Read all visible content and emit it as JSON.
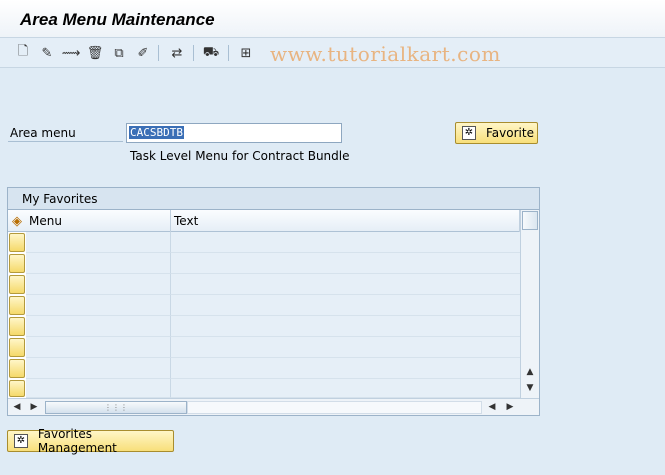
{
  "window": {
    "title": "Area Menu Maintenance"
  },
  "toolbar": {
    "buttons": [
      {
        "name": "create-icon",
        "glyph": "🗋"
      },
      {
        "name": "change-icon",
        "glyph": "✎"
      },
      {
        "name": "display-icon",
        "glyph": "⟿"
      },
      {
        "name": "delete-icon",
        "glyph": "🗑"
      },
      {
        "name": "copy-icon",
        "glyph": "⧉"
      },
      {
        "name": "edit-icon",
        "glyph": "✐"
      },
      {
        "name": "transport-icon",
        "glyph": "⇄"
      },
      {
        "name": "truck-icon",
        "glyph": "⛟"
      },
      {
        "name": "import-icon",
        "glyph": "⊞"
      }
    ],
    "watermark": "www.tutorialkart.com"
  },
  "form": {
    "area_menu_label": "Area menu",
    "area_menu_value": "CACSBDTB",
    "description": "Task Level Menu for Contract Bundle",
    "favorite_button": "Favorite"
  },
  "favorites": {
    "panel_title": "My Favorites",
    "columns": [
      "Menu",
      "Text"
    ],
    "rows": [
      {
        "menu": "",
        "text": ""
      },
      {
        "menu": "",
        "text": ""
      },
      {
        "menu": "",
        "text": ""
      },
      {
        "menu": "",
        "text": ""
      },
      {
        "menu": "",
        "text": ""
      },
      {
        "menu": "",
        "text": ""
      },
      {
        "menu": "",
        "text": ""
      },
      {
        "menu": "",
        "text": ""
      }
    ]
  },
  "footer": {
    "favorites_management_button": "Favorites Management"
  },
  "colors": {
    "background": "#dfebf5",
    "button": "#f8df7a",
    "selection": "#3b6fb6"
  }
}
